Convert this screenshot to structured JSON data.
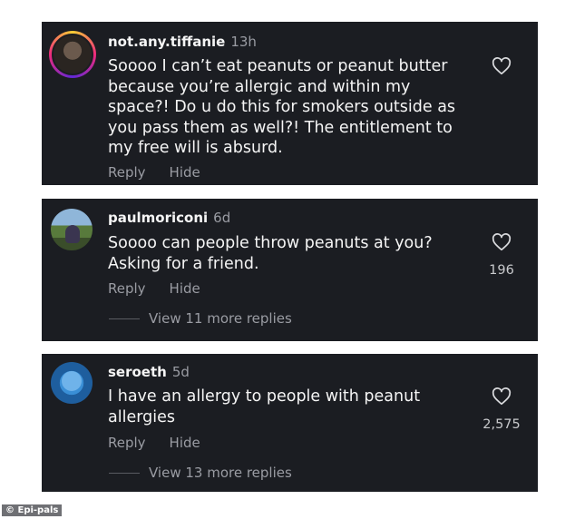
{
  "comments": [
    {
      "username": "not.any.tiffanie",
      "time": "13h",
      "text": "Soooo I can’t eat peanuts or peanut butter because you’re allergic and within my space?! Do u do this for smokers outside as you pass them as well?! The entitlement to my free will is absurd.",
      "reply_label": "Reply",
      "hide_label": "Hide",
      "likes": "",
      "view_replies": ""
    },
    {
      "username": "paulmoriconi",
      "time": "6d",
      "text": "Soooo can people throw peanuts at you? Asking for a friend.",
      "reply_label": "Reply",
      "hide_label": "Hide",
      "likes": "196",
      "view_replies": "View 11 more replies"
    },
    {
      "username": "seroeth",
      "time": "5d",
      "text": "I have an allergy to people with peanut allergies",
      "reply_label": "Reply",
      "hide_label": "Hide",
      "likes": "2,575",
      "view_replies": "View 13 more replies"
    }
  ],
  "credit": "Epi-pals",
  "icons": {
    "like": "heart-outline-icon"
  },
  "colors": {
    "card_bg": "#1b1d22",
    "text": "#f5f5f5",
    "muted": "#9a9ca3"
  }
}
